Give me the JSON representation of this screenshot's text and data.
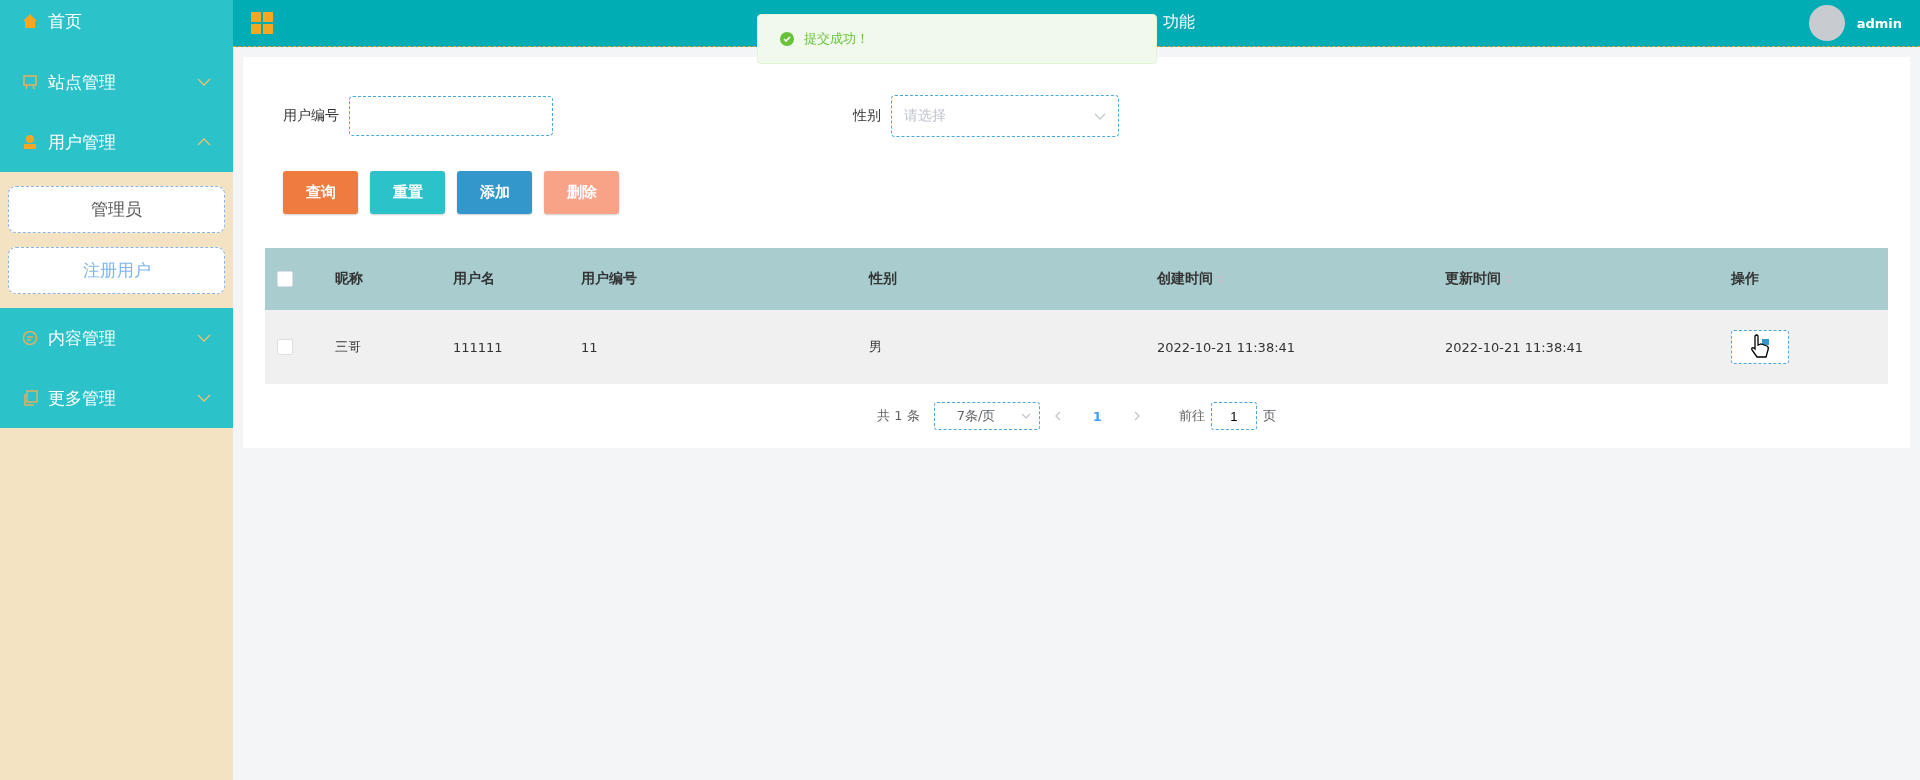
{
  "sidebar": {
    "items": [
      {
        "label": "首页"
      },
      {
        "label": "站点管理",
        "expanded": false
      },
      {
        "label": "用户管理",
        "expanded": true,
        "children": [
          {
            "label": "管理员",
            "selected": false
          },
          {
            "label": "注册用户",
            "selected": true
          }
        ]
      },
      {
        "label": "内容管理",
        "expanded": false
      },
      {
        "label": "更多管理",
        "expanded": false
      }
    ]
  },
  "header": {
    "title": "功能",
    "user": "admin"
  },
  "toast": {
    "message": "提交成功！"
  },
  "search": {
    "fields": [
      {
        "label": "用户编号",
        "kind": "input"
      },
      {
        "label": "性别",
        "kind": "select",
        "placeholder": "请选择"
      }
    ],
    "buttons": [
      {
        "label": "查询",
        "color": "#ef7b3f"
      },
      {
        "label": "重置",
        "color": "#2bc3c9"
      },
      {
        "label": "添加",
        "color": "#3397cc"
      },
      {
        "label": "删除",
        "color": "#f8a387"
      }
    ]
  },
  "table": {
    "columns": [
      {
        "label": "昵称"
      },
      {
        "label": "用户名"
      },
      {
        "label": "用户编号"
      },
      {
        "label": "性别"
      },
      {
        "label": "创建时间",
        "sortable": true
      },
      {
        "label": "更新时间",
        "sortable": true
      },
      {
        "label": "操作"
      }
    ],
    "all_checked": false,
    "rows": [
      {
        "checked": false,
        "cells": [
          "三哥",
          "111111",
          "11",
          "男",
          "2022-10-21 11:38:41",
          "2022-10-21 11:38:41"
        ]
      }
    ]
  },
  "pagination": {
    "total": "共 1 条",
    "page_size": "7条/页",
    "pages": [
      {
        "label": "1",
        "selected": true
      }
    ],
    "goto_label": "前往",
    "goto_value": "1",
    "goto_suffix": "页"
  }
}
